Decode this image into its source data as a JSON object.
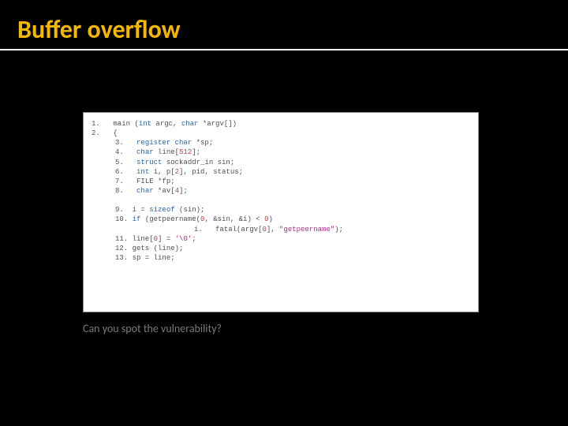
{
  "title": "Buffer overflow",
  "caption": "Can you spot the vulnerability?",
  "code": {
    "l1": {
      "n": "1.",
      "a": " main (",
      "b": "int",
      "c": " argc, ",
      "d": "char",
      "e": " *argv[])"
    },
    "l2": {
      "n": "2.",
      "a": " {"
    },
    "l3": {
      "n": "3.",
      "a": "register char",
      "b": " *sp;"
    },
    "l4": {
      "n": "4.",
      "a": "char",
      "b": " line[",
      "c": "512",
      "d": "];"
    },
    "l5": {
      "n": "5.",
      "a": "struct",
      "b": " sockaddr_in sin;"
    },
    "l6": {
      "n": "6.",
      "a": "int",
      "b": " i, p[",
      "c": "2",
      "d": "], pid, status;"
    },
    "l7": {
      "n": "7.",
      "a": "FILE *fp;"
    },
    "l8": {
      "n": "8.",
      "a": "char",
      "b": " *av[",
      "c": "4",
      "d": "];"
    },
    "l9": {
      "n": "9.",
      "a": "i = ",
      "b": "sizeof",
      "c": " (sin);"
    },
    "l10": {
      "n": "10.",
      "a": "if",
      "b": " (getpeername(",
      "c": "0",
      "d": ", &sin, &i) < ",
      "e": "0",
      "f": ")"
    },
    "l10i": {
      "n": "i.",
      "a": "fatal(argv[",
      "b": "0",
      "c": "], ",
      "d": "\"getpeername\"",
      "e": ");"
    },
    "l11": {
      "n": "11.",
      "a": "line[",
      "b": "0",
      "c": "] = ",
      "d": "'\\0'",
      "e": ";"
    },
    "l12": {
      "n": "12.",
      "a": "gets (line);"
    },
    "l13": {
      "n": "13.",
      "a": "sp = line;"
    }
  }
}
